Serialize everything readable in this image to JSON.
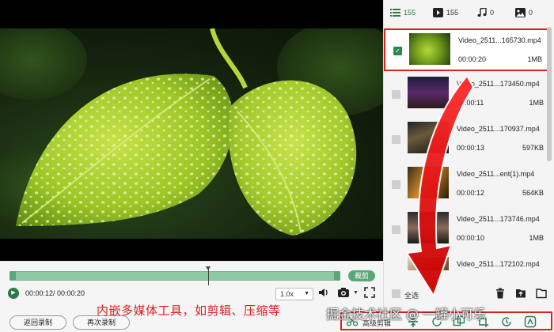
{
  "colors": {
    "accent": "#2a7a4a",
    "highlight": "#e02020"
  },
  "tabs": [
    {
      "icon": "list-icon",
      "count": "155"
    },
    {
      "icon": "video-icon",
      "count": "155"
    },
    {
      "icon": "music-icon",
      "count": "0"
    },
    {
      "icon": "image-icon",
      "count": "0"
    }
  ],
  "media_items": [
    {
      "name": "Video_2511...165730.mp4",
      "duration": "00:00:20",
      "size": "1MB",
      "selected": true
    },
    {
      "name": "Video_2511...173450.mp4",
      "duration": "00:00:11",
      "size": "1MB",
      "selected": false
    },
    {
      "name": "Video_2511...170937.mp4",
      "duration": "00:00:13",
      "size": "597KB",
      "selected": false
    },
    {
      "name": "Video_2511...ent(1).mp4",
      "duration": "00:00:12",
      "size": "564KB",
      "selected": false
    },
    {
      "name": "Video_2511...173746.mp4",
      "duration": "00:00:10",
      "size": "1MB",
      "selected": false
    },
    {
      "name": "Video_2511...172102.mp4",
      "duration": "",
      "size": "",
      "selected": false
    }
  ],
  "player": {
    "trim_label": "裁剪",
    "time": "00:00:12/ 00:00:20",
    "playback_progress": 0.6,
    "speed": "1.0x",
    "return_record_label": "返回录制",
    "record_again_label": "再次录制"
  },
  "panel": {
    "select_all_label": "全选",
    "tools_label": "高级剪辑"
  },
  "overlay": {
    "caption": "内嵌多媒体工具，如剪辑、压缩等",
    "watermark": "掘金技术社区 @ 一罐小可乐"
  }
}
